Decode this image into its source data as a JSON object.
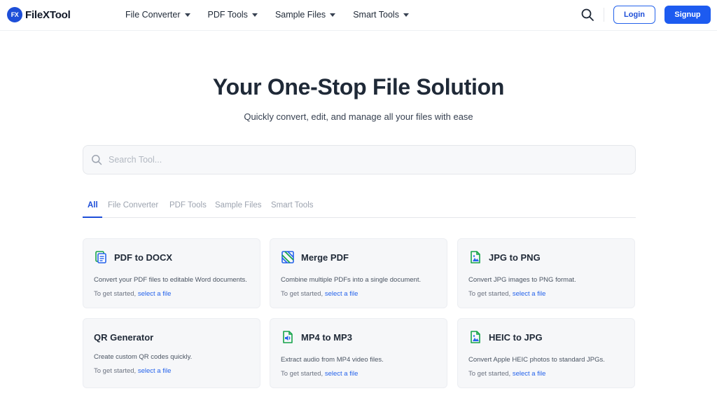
{
  "brand": {
    "mark": "FX",
    "name": "FileXTool"
  },
  "nav": {
    "items": [
      {
        "label": "File Converter"
      },
      {
        "label": "PDF Tools"
      },
      {
        "label": "Sample Files"
      },
      {
        "label": "Smart Tools"
      }
    ],
    "login_label": "Login",
    "signup_label": "Signup"
  },
  "hero": {
    "title": "Your One-Stop File Solution",
    "subtitle": "Quickly convert, edit, and manage all your files with ease"
  },
  "search": {
    "placeholder": "Search Tool..."
  },
  "tabs": [
    {
      "label": "All",
      "active": true
    },
    {
      "label": "File Converter"
    },
    {
      "label": "PDF Tools"
    },
    {
      "label": "Sample Files"
    },
    {
      "label": "Smart Tools"
    }
  ],
  "cards": [
    {
      "title": "PDF to DOCX",
      "icon": "doc-icon",
      "description": "Convert your PDF files to editable Word documents.",
      "cta_prefix": "To get started,",
      "cta_link": "select a file"
    },
    {
      "title": "Merge PDF",
      "icon": "merge-icon",
      "description": "Combine multiple PDFs into a single document.",
      "cta_prefix": "To get started,",
      "cta_link": "select a file"
    },
    {
      "title": "JPG to PNG",
      "icon": "image-file-icon",
      "description": "Convert JPG images to PNG format.",
      "cta_prefix": "To get started,",
      "cta_link": "select a file"
    },
    {
      "title": "QR Generator",
      "icon": "",
      "description": "Create custom QR codes quickly.",
      "cta_prefix": "To get started,",
      "cta_link": "select a file"
    },
    {
      "title": "MP4 to MP3",
      "icon": "audio-file-icon",
      "description": "Extract audio from MP4 video files.",
      "cta_prefix": "To get started,",
      "cta_link": "select a file"
    },
    {
      "title": "HEIC to JPG",
      "icon": "image-file-icon",
      "description": "Convert Apple HEIC photos to standard JPGs.",
      "cta_prefix": "To get started,",
      "cta_link": "select a file"
    }
  ],
  "colors": {
    "accent": "#1d4ed8",
    "icon_green": "#16a34a",
    "icon_blue": "#2563eb"
  }
}
